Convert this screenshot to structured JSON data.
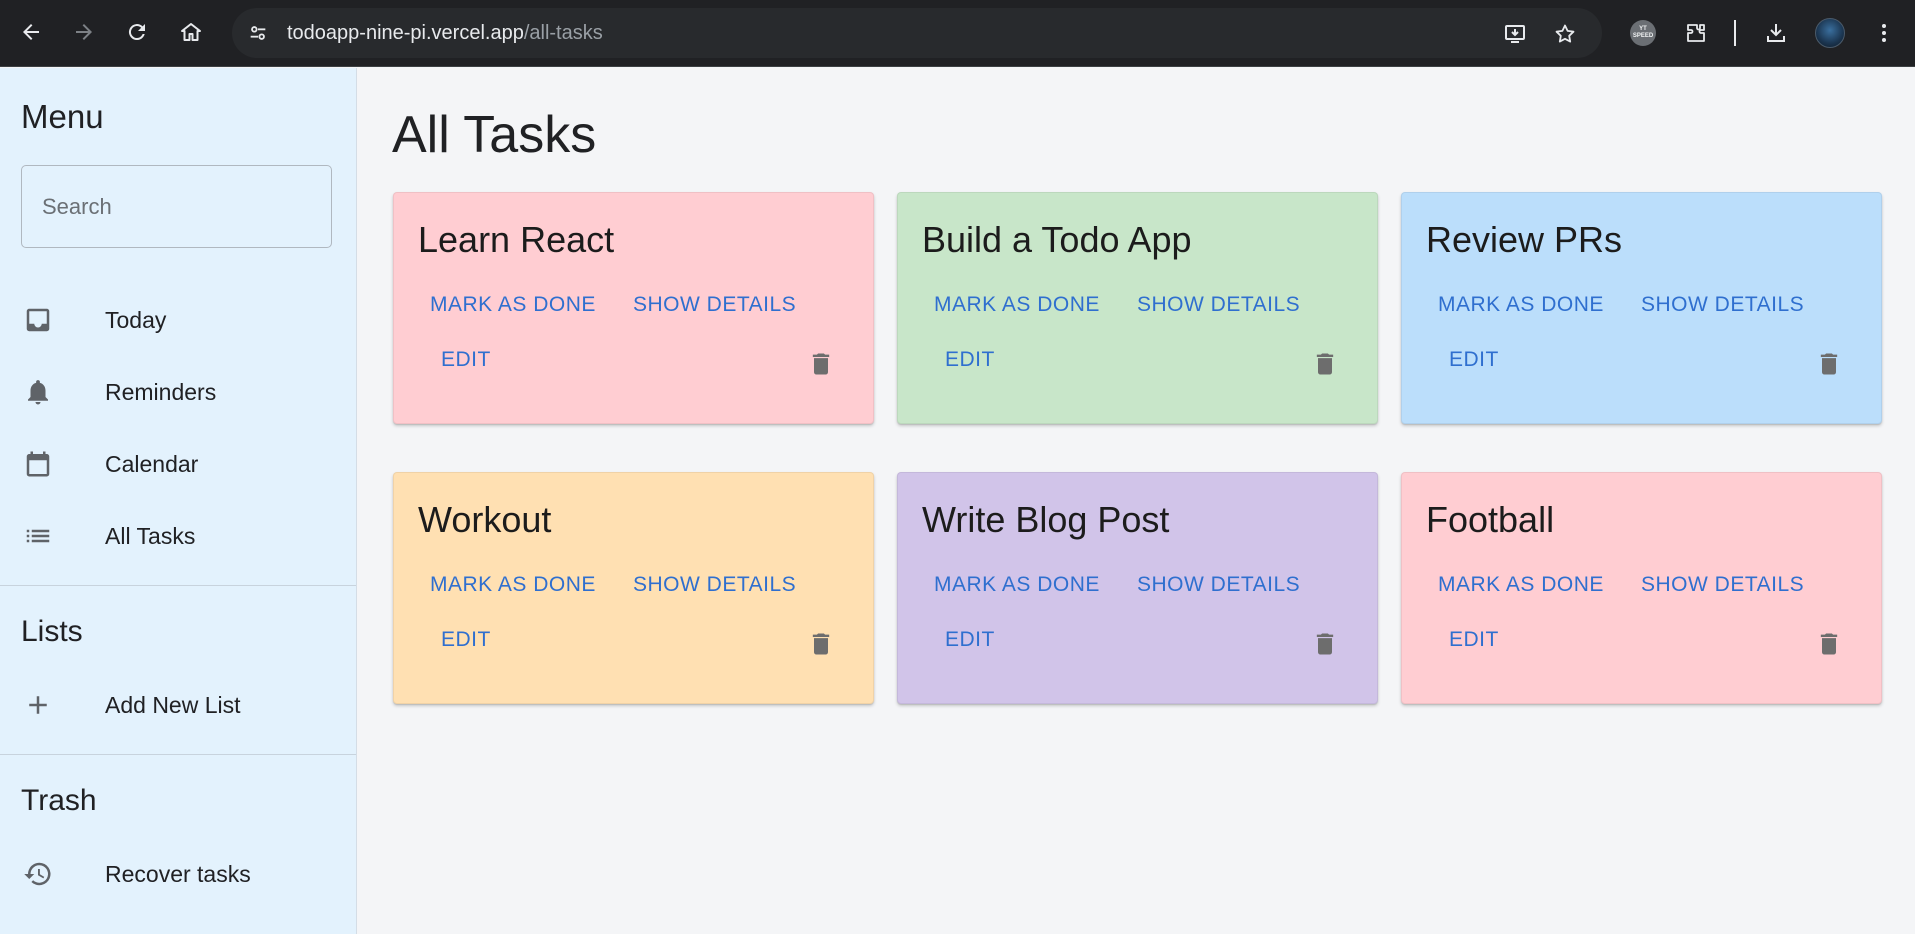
{
  "browser": {
    "url_host": "todoapp-nine-pi.vercel.app",
    "url_path": "/all-tasks",
    "extension_badge": "YT SPEED"
  },
  "sidebar": {
    "menu_heading": "Menu",
    "search_placeholder": "Search",
    "menu_items": [
      {
        "label": "Today",
        "icon": "inbox-icon"
      },
      {
        "label": "Reminders",
        "icon": "bell-icon"
      },
      {
        "label": "Calendar",
        "icon": "calendar-icon"
      },
      {
        "label": "All Tasks",
        "icon": "list-icon"
      }
    ],
    "lists_heading": "Lists",
    "add_list_label": "Add New List",
    "trash_heading": "Trash",
    "recover_label": "Recover tasks"
  },
  "main": {
    "title": "All Tasks",
    "actions": {
      "mark_done": "MARK AS DONE",
      "show_details": "SHOW DETAILS",
      "edit": "EDIT"
    },
    "tasks": [
      {
        "title": "Learn React",
        "color": "#ffcdd2"
      },
      {
        "title": "Build a Todo App",
        "color": "#c8e6c9"
      },
      {
        "title": "Review PRs",
        "color": "#bbdefb"
      },
      {
        "title": "Workout",
        "color": "#ffe0b2"
      },
      {
        "title": "Write Blog Post",
        "color": "#d1c4e9"
      },
      {
        "title": "Football",
        "color": "#ffcdd2"
      }
    ]
  },
  "colors": {
    "sidebar_bg": "#e3f2fd",
    "page_bg": "#f4f5f7",
    "accent": "#2f6fcf",
    "trash_icon": "#6d6d6d"
  }
}
